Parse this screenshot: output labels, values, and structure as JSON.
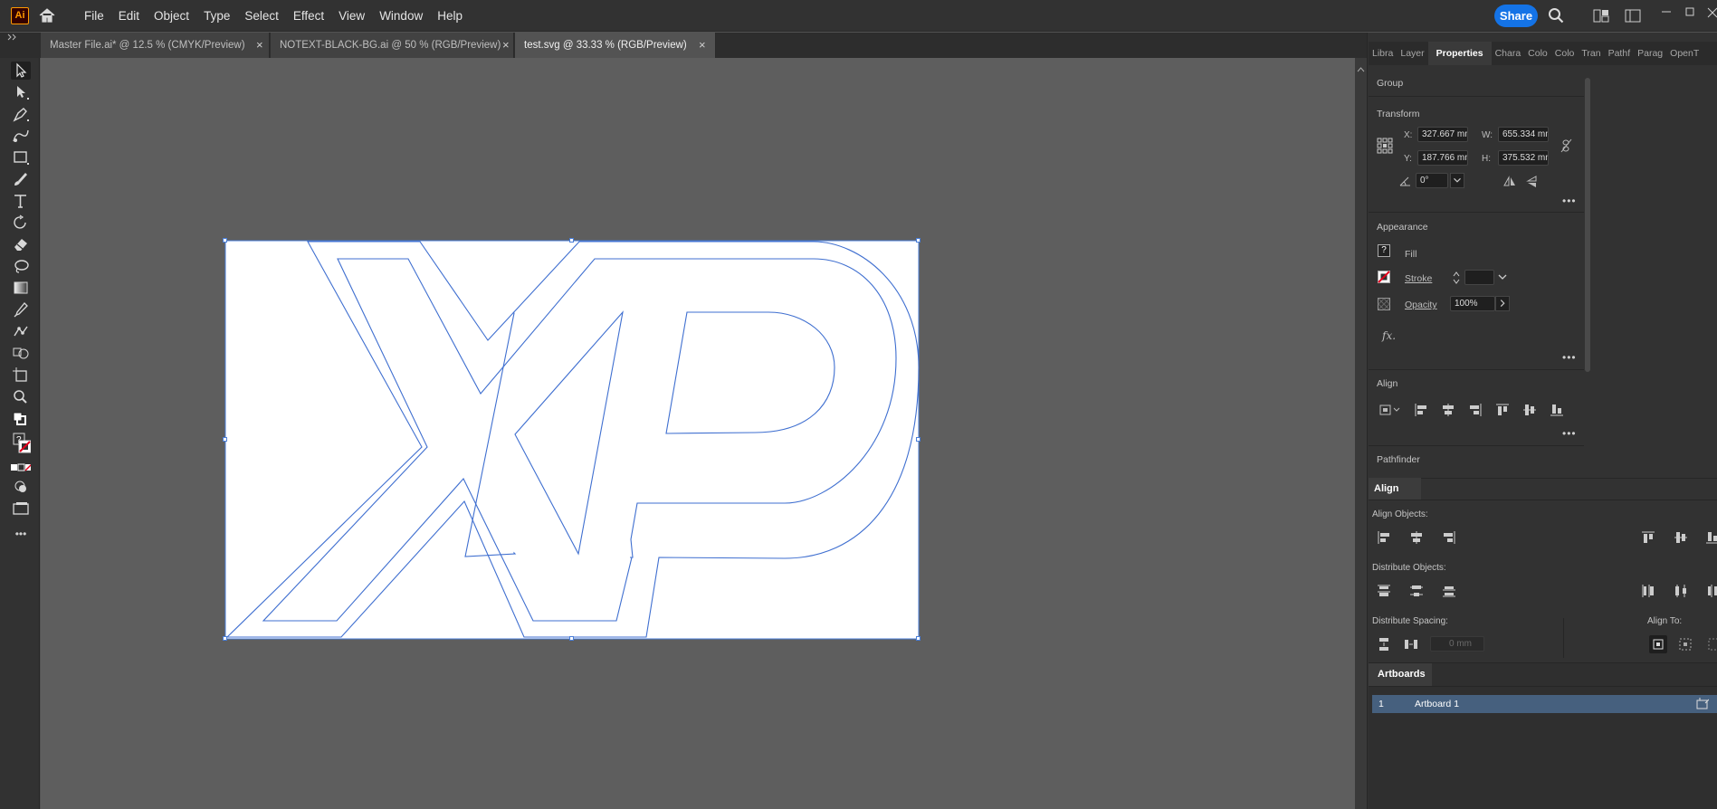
{
  "app": {
    "logo_text": "Ai",
    "menu": [
      "File",
      "Edit",
      "Object",
      "Type",
      "Select",
      "Effect",
      "View",
      "Window",
      "Help"
    ],
    "share_label": "Share"
  },
  "tabs": [
    {
      "label": "Master File.ai* @ 12.5 % (CMYK/Preview)",
      "close": "×",
      "active": false
    },
    {
      "label": "NOTEXT-BLACK-BG.ai @ 50 % (RGB/Preview)",
      "close": "×",
      "active": false
    },
    {
      "label": "test.svg @ 33.33 % (RGB/Preview)",
      "close": "×",
      "active": true
    }
  ],
  "toolbar": {
    "tools": [
      "selection-tool",
      "direct-selection-tool",
      "pen-tool",
      "curvature-tool",
      "rectangle-tool",
      "paintbrush-tool",
      "type-tool",
      "rotate-tool",
      "eraser-tool",
      "lasso-tool",
      "gradient-tool",
      "eyedropper-tool",
      "puppet-warp-tool",
      "shape-builder-tool",
      "artboard-tool",
      "zoom-tool"
    ],
    "more_label": "•••"
  },
  "panel_tabs": [
    "Libra",
    "Layer",
    "Properties",
    "Chara",
    "Colo",
    "Colo",
    "Tran",
    "Pathf",
    "Parag",
    "OpenT"
  ],
  "properties": {
    "group_label": "Group",
    "transform": {
      "title": "Transform",
      "x_label": "X:",
      "x_value": "327.667 mm",
      "y_label": "Y:",
      "y_value": "187.766 mm",
      "w_label": "W:",
      "w_value": "655.334 mm",
      "h_label": "H:",
      "h_value": "375.532 mm",
      "angle_value": "0°"
    },
    "appearance": {
      "title": "Appearance",
      "fill_label": "Fill",
      "fill_swatch": "?",
      "stroke_label": "Stroke",
      "opacity_label": "Opacity",
      "opacity_value": "100%",
      "fx_label": "fx."
    },
    "align_title": "Align",
    "pathfinder_title": "Pathfinder",
    "more": "•••"
  },
  "align_panel": {
    "title": "Align",
    "align_objects_label": "Align Objects:",
    "distribute_objects_label": "Distribute Objects:",
    "distribute_spacing_label": "Distribute Spacing:",
    "spacing_value": "0 mm",
    "align_to_label": "Align To:"
  },
  "artboards_panel": {
    "title": "Artboards",
    "rows": [
      {
        "number": "1",
        "name": "Artboard 1"
      }
    ]
  },
  "colors": {
    "accent_blue": "#1473e6",
    "selection_blue": "#4a7ed8",
    "artboard_row": "#46607e"
  }
}
